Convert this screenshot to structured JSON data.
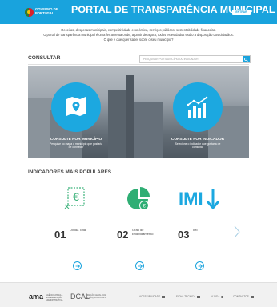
{
  "header": {
    "logo_text": "GOVERNO DE\nPORTUGAL",
    "title": "PORTAL DE TRANSPARÊNCIA MUNICIPAL",
    "login_label": "ENTRAR"
  },
  "intro": {
    "line1": "Receitas, despesas municipais, competitividade económica, serviços públicos, sustentabilidade financeira.",
    "line2": "O portal de transparência municipal é uma ferramenta onde, a partir de agora, todos estes dados estão à disposição dos cidadãos.",
    "line3": "O que é que quer saber sobre o seu município?"
  },
  "consult": {
    "heading": "CONSULTAR",
    "search_placeholder": "PESQUISAR POR MUNICÍPIO OU INDICADOR",
    "by_municipality": {
      "title": "CONSULTE POR MUNICÍPIO",
      "subtitle": "Pesquise no mapa o município que gostaria de conhecer"
    },
    "by_indicator": {
      "title": "CONSULTE POR INDICADOR",
      "subtitle": "Selecione o indicador que gostaria de consultar"
    }
  },
  "popular": {
    "heading": "INDICADORES MAIS POPULARES",
    "items": [
      {
        "rank": "01",
        "label": "Dívida Total",
        "icon": "euro-dashed-icon"
      },
      {
        "rank": "02",
        "label": "Grau de Endividamento",
        "icon": "pie-euro-icon"
      },
      {
        "rank": "03",
        "label": "IMI",
        "icon": "imi-down-icon"
      }
    ]
  },
  "footer": {
    "ama": "ama",
    "ama_sub": "AGÊNCIA PARA A\nMODERNIZAÇÃO\nADMINISTRATIVA",
    "dcal": "DCAL",
    "dcal_sub": "DIREÇÃO GERAL DAS\nAUTARQUIAS LOCAIS",
    "links": [
      "ACESSIBILIDADE",
      "FICHA TÉCNICA",
      "AJUDA",
      "CONTACTOS"
    ]
  },
  "colors": {
    "brand": "#19a3dd",
    "text": "#333333"
  }
}
